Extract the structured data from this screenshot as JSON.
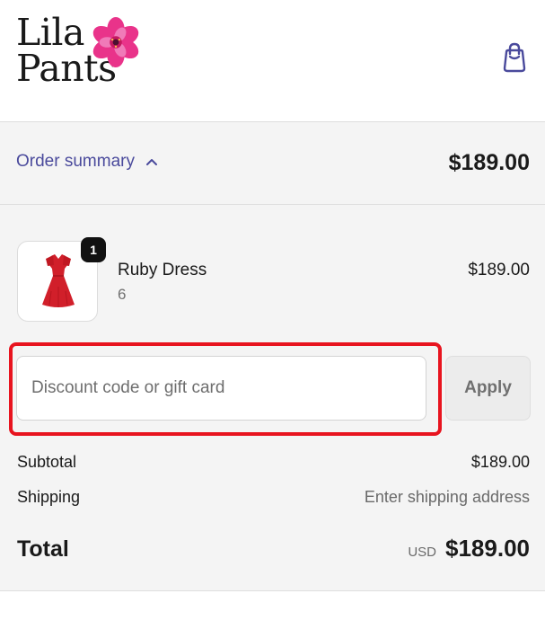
{
  "header": {
    "logo": {
      "line1": "Lila",
      "line2": "Pants",
      "flower_colors": [
        "#e9338a",
        "#f07ab8",
        "#c4185f"
      ]
    },
    "cart_icon": "shopping-bag-icon",
    "accent_color": "#4a4a9c"
  },
  "summary_bar": {
    "toggle_label": "Order summary",
    "chevron": "chevron-up-icon",
    "total": "$189.00"
  },
  "line_items": [
    {
      "name": "Ruby Dress",
      "variant": "6",
      "price": "$189.00",
      "quantity": "1",
      "image": "red-dress"
    }
  ],
  "discount": {
    "placeholder": "Discount code or gift card",
    "value": "",
    "apply_label": "Apply",
    "highlight_color": "#e8141f"
  },
  "totals": {
    "subtotal_label": "Subtotal",
    "subtotal_value": "$189.00",
    "shipping_label": "Shipping",
    "shipping_value": "Enter shipping address",
    "total_label": "Total",
    "currency": "USD",
    "total_value": "$189.00"
  }
}
